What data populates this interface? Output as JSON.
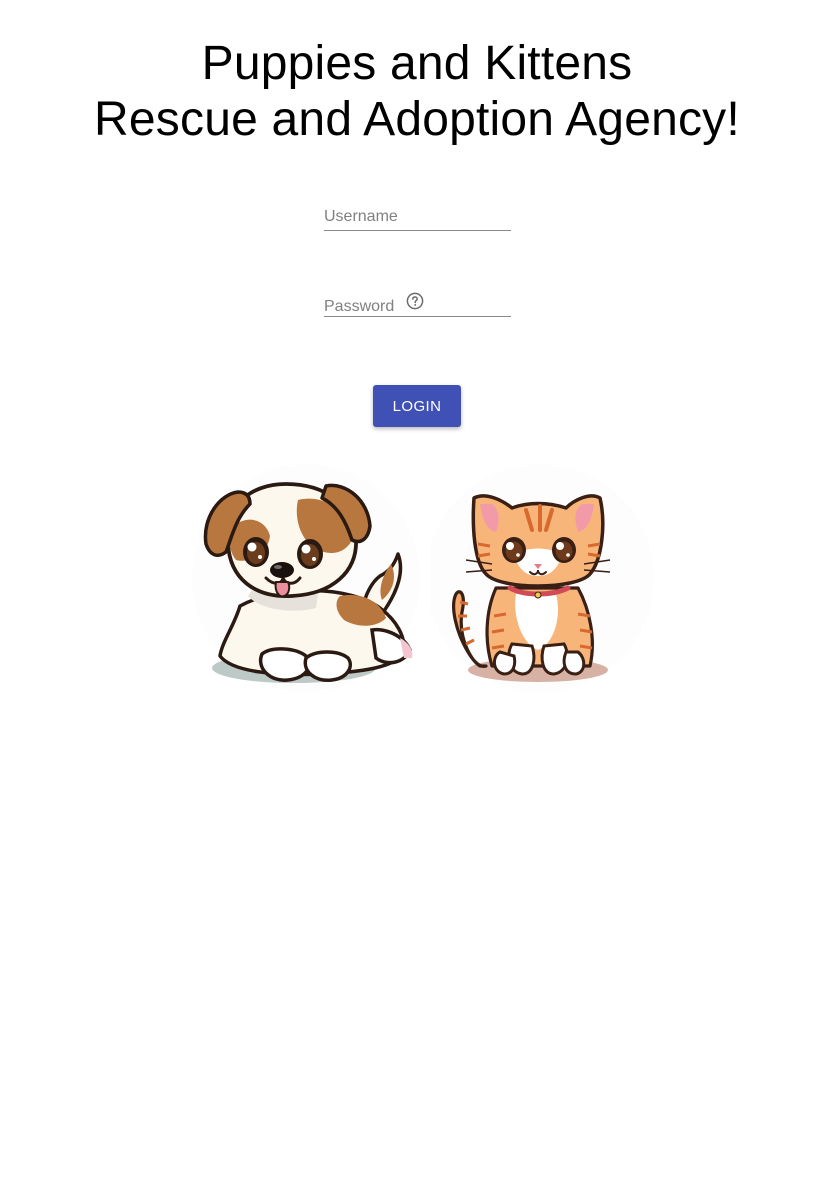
{
  "header": {
    "title_line1": "Puppies and Kittens",
    "title_line2": "Rescue and Adoption Agency!"
  },
  "login_form": {
    "username_placeholder": "Username",
    "username_value": "",
    "password_placeholder": "Password",
    "password_value": "",
    "password_help_icon": "help-circle-icon",
    "login_label": "LOGIN"
  },
  "illustrations": [
    {
      "name": "puppy-illustration",
      "kind": "cartoon puppy"
    },
    {
      "name": "kitten-illustration",
      "kind": "cartoon kitten"
    }
  ],
  "colors": {
    "primary": "#3f51b5",
    "button_text": "#ffffff",
    "placeholder": "#808080",
    "underline": "#8a8a8a"
  }
}
